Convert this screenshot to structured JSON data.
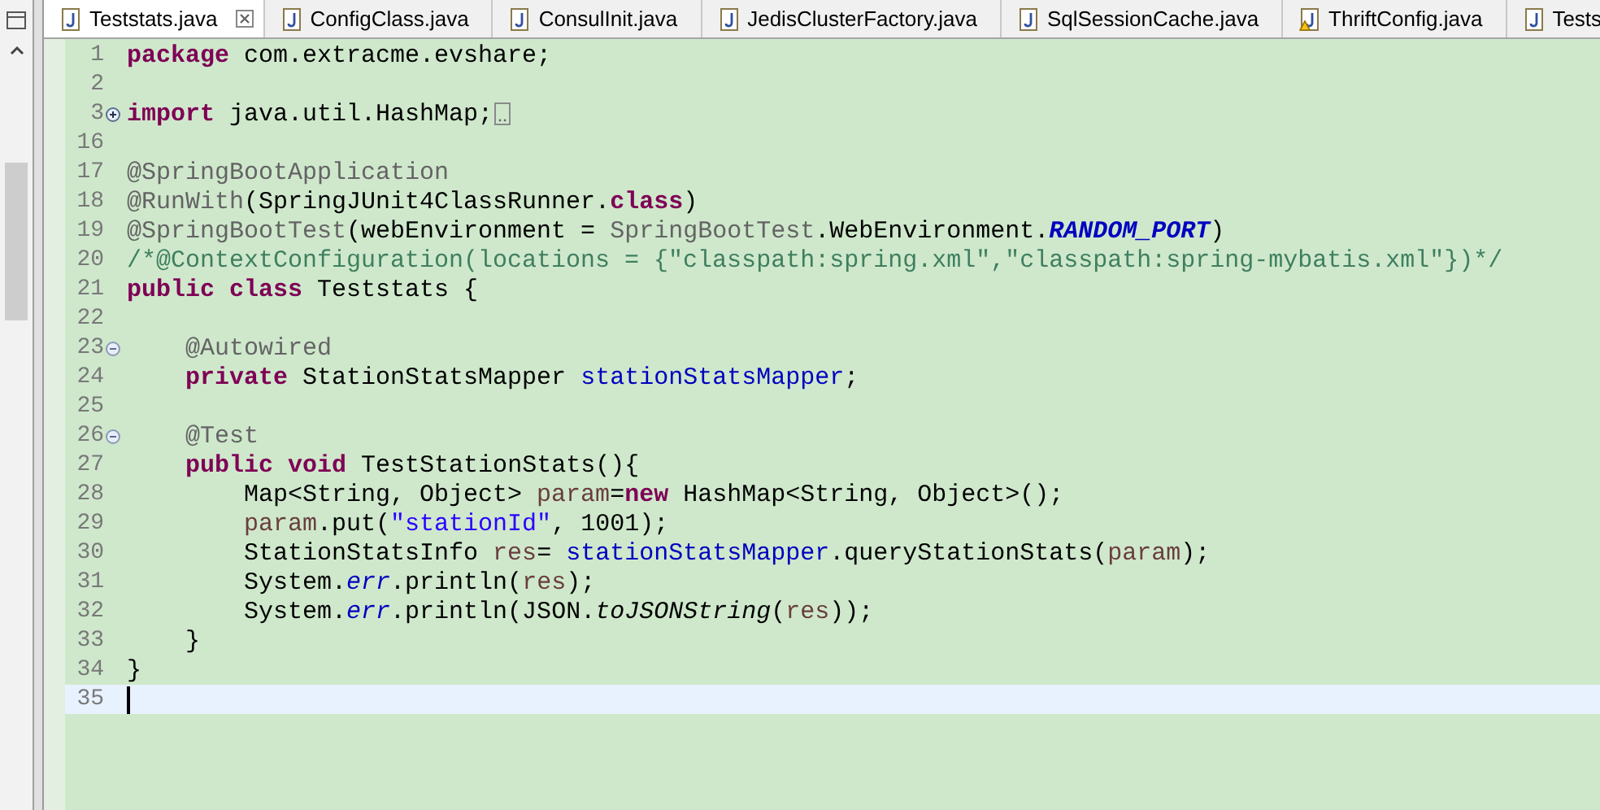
{
  "tabs": [
    {
      "label": "Teststats.java",
      "selected": true,
      "kind": "java"
    },
    {
      "label": "ConfigClass.java",
      "selected": false,
      "kind": "java"
    },
    {
      "label": "ConsulInit.java",
      "selected": false,
      "kind": "java"
    },
    {
      "label": "JedisClusterFactory.java",
      "selected": false,
      "kind": "java"
    },
    {
      "label": "SqlSessionCache.java",
      "selected": false,
      "kind": "java"
    },
    {
      "label": "ThriftConfig.java",
      "selected": false,
      "kind": "java-warning"
    },
    {
      "label": "Tests",
      "selected": false,
      "kind": "java"
    }
  ],
  "lines": [
    {
      "number": "1",
      "tokens": [
        {
          "kind": "keyword",
          "text": "package"
        },
        {
          "kind": "plain",
          "text": " com.extracme.evshare;"
        }
      ]
    },
    {
      "number": "2"
    },
    {
      "number": "3",
      "expanded": false,
      "tokens": [
        {
          "kind": "keyword",
          "text": "import"
        },
        {
          "kind": "plain",
          "text": " java.util.HashMap;"
        }
      ]
    },
    {
      "number": "16"
    },
    {
      "number": "17",
      "tokens": [
        {
          "kind": "annotation",
          "text": "@SpringBootApplication"
        }
      ]
    },
    {
      "number": "18",
      "tokens": [
        {
          "kind": "annotation",
          "text": "@RunWith"
        },
        {
          "kind": "plain",
          "text": "(SpringJUnit4ClassRunner."
        },
        {
          "kind": "keyword",
          "text": "class"
        },
        {
          "kind": "plain",
          "text": ")"
        }
      ]
    },
    {
      "number": "19",
      "tokens": [
        {
          "kind": "annotation",
          "text": "@SpringBootTest"
        },
        {
          "kind": "plain",
          "text": "(webEnvironment = "
        },
        {
          "kind": "annotation",
          "text": "SpringBootTest"
        },
        {
          "kind": "plain",
          "text": ".WebEnvironment."
        },
        {
          "kind": "constant",
          "text": "RANDOM_PORT"
        },
        {
          "kind": "plain",
          "text": ")"
        }
      ]
    },
    {
      "number": "20",
      "tokens": [
        {
          "kind": "comment",
          "text": "/*@ContextConfiguration(locations = {\"classpath:spring.xml\",\"classpath:spring-mybatis.xml\"})*/"
        }
      ]
    },
    {
      "number": "21",
      "tokens": [
        {
          "kind": "keyword",
          "text": "public "
        },
        {
          "kind": "keyword",
          "text": "class"
        },
        {
          "kind": "plain",
          "text": " Teststats {"
        }
      ]
    },
    {
      "number": "22"
    },
    {
      "number": "23",
      "expanded": true,
      "tokens": [
        {
          "kind": "annotation",
          "text": "    @Autowired"
        }
      ]
    },
    {
      "number": "24",
      "tokens": [
        {
          "kind": "keyword",
          "text": "    private"
        },
        {
          "kind": "plain",
          "text": " StationStatsMapper "
        },
        {
          "kind": "field",
          "text": "stationStatsMapper"
        },
        {
          "kind": "plain",
          "text": ";"
        }
      ]
    },
    {
      "number": "25"
    },
    {
      "number": "26",
      "expanded": true,
      "tokens": [
        {
          "kind": "annotation",
          "text": "    @Test"
        }
      ]
    },
    {
      "number": "27",
      "tokens": [
        {
          "kind": "keyword",
          "text": "    public "
        },
        {
          "kind": "keyword",
          "text": "void"
        },
        {
          "kind": "plain",
          "text": " TestStationStats(){"
        }
      ]
    },
    {
      "number": "28",
      "tokens": [
        {
          "kind": "plain",
          "text": "        Map<String, Object> "
        },
        {
          "kind": "local",
          "text": "param"
        },
        {
          "kind": "plain",
          "text": "="
        },
        {
          "kind": "keyword",
          "text": "new"
        },
        {
          "kind": "plain",
          "text": " HashMap<String, Object>();"
        }
      ]
    },
    {
      "number": "29",
      "tokens": [
        {
          "kind": "local",
          "text": "        param"
        },
        {
          "kind": "plain",
          "text": ".put("
        },
        {
          "kind": "string",
          "text": "\"stationId\""
        },
        {
          "kind": "plain",
          "text": ", 1001);"
        }
      ]
    },
    {
      "number": "30",
      "tokens": [
        {
          "kind": "plain",
          "text": "        StationStatsInfo "
        },
        {
          "kind": "local",
          "text": "res"
        },
        {
          "kind": "plain",
          "text": "= "
        },
        {
          "kind": "field",
          "text": "stationStatsMapper"
        },
        {
          "kind": "plain",
          "text": ".queryStationStats("
        },
        {
          "kind": "local",
          "text": "param"
        },
        {
          "kind": "plain",
          "text": ");"
        }
      ]
    },
    {
      "number": "31",
      "tokens": [
        {
          "kind": "plain",
          "text": "        System."
        },
        {
          "kind": "static-field",
          "text": "err"
        },
        {
          "kind": "plain",
          "text": ".println("
        },
        {
          "kind": "local",
          "text": "res"
        },
        {
          "kind": "plain",
          "text": ");"
        }
      ]
    },
    {
      "number": "32",
      "tokens": [
        {
          "kind": "plain",
          "text": "        System."
        },
        {
          "kind": "static-field",
          "text": "err"
        },
        {
          "kind": "plain",
          "text": ".println(JSON."
        },
        {
          "kind": "static-method",
          "text": "toJSONString"
        },
        {
          "kind": "plain",
          "text": "("
        },
        {
          "kind": "local",
          "text": "res"
        },
        {
          "kind": "plain",
          "text": "));"
        }
      ]
    },
    {
      "number": "33",
      "tokens": [
        {
          "kind": "plain",
          "text": "    }"
        }
      ]
    },
    {
      "number": "34",
      "tokens": [
        {
          "kind": "plain",
          "text": "}"
        }
      ]
    },
    {
      "number": "35",
      "current": true
    }
  ]
}
